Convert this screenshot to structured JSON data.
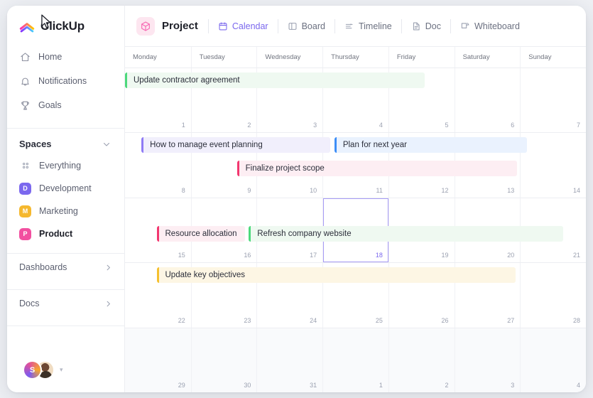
{
  "brand": {
    "name": "ClickUp",
    "logo_icon": "clickup-logo-icon"
  },
  "sidebar": {
    "nav": [
      {
        "label": "Home",
        "icon": "home-icon"
      },
      {
        "label": "Notifications",
        "icon": "bell-icon"
      },
      {
        "label": "Goals",
        "icon": "trophy-icon"
      }
    ],
    "spaces_section": {
      "title": "Spaces",
      "chevron": "chevron-down-icon"
    },
    "spaces": [
      {
        "label": "Everything",
        "badge": "",
        "color": "",
        "icon": "grid-dots-icon",
        "active": false
      },
      {
        "label": "Development",
        "badge": "D",
        "color": "#7b68ee",
        "active": false
      },
      {
        "label": "Marketing",
        "badge": "M",
        "color": "#f5b82e",
        "active": false
      },
      {
        "label": "Product",
        "badge": "P",
        "color": "#f24fa0",
        "active": true
      }
    ],
    "links": [
      {
        "label": "Dashboards",
        "chevron": "chevron-right-icon"
      },
      {
        "label": "Docs",
        "chevron": "chevron-right-icon"
      }
    ],
    "footer": {
      "avatar_initial": "S",
      "avatar_photo": "user-photo-avatar",
      "caret": "chevron-down-icon"
    }
  },
  "toolbar": {
    "project_name": "Project",
    "project_icon": "cube-icon",
    "tabs": [
      {
        "label": "Calendar",
        "icon": "calendar-icon",
        "active": true
      },
      {
        "label": "Board",
        "icon": "board-icon",
        "active": false
      },
      {
        "label": "Timeline",
        "icon": "timeline-icon",
        "active": false
      },
      {
        "label": "Doc",
        "icon": "doc-icon",
        "active": false
      },
      {
        "label": "Whiteboard",
        "icon": "whiteboard-icon",
        "active": false
      }
    ],
    "accent_color": "#7b68ee"
  },
  "calendar": {
    "day_names": [
      "Monday",
      "Tuesday",
      "Wednesday",
      "Thursday",
      "Friday",
      "Saturday",
      "Sunday"
    ],
    "today": 18,
    "weeks": [
      {
        "days": [
          1,
          2,
          3,
          4,
          5,
          6,
          7
        ],
        "out_of_month": false
      },
      {
        "days": [
          8,
          9,
          10,
          11,
          12,
          13,
          14
        ],
        "out_of_month": false
      },
      {
        "days": [
          15,
          16,
          17,
          18,
          19,
          20,
          21
        ],
        "out_of_month": false
      },
      {
        "days": [
          22,
          23,
          24,
          25,
          26,
          27,
          28
        ],
        "out_of_month": false
      },
      {
        "days": [
          29,
          30,
          31,
          1,
          2,
          3,
          4
        ],
        "out_of_month": true
      }
    ],
    "events": [
      {
        "title": "Update contractor agreement",
        "week": 0,
        "row": 0,
        "start_day": 0,
        "end_day": 4.55,
        "accent": "#4cd97b",
        "fill": "#eff9f1"
      },
      {
        "title": "How to manage event planning",
        "week": 1,
        "row": 0,
        "start_day": 0.25,
        "end_day": 3.12,
        "accent": "#8f7bf5",
        "fill": "#f1effc"
      },
      {
        "title": "Plan for next year",
        "week": 1,
        "row": 0,
        "start_day": 3.18,
        "end_day": 6.1,
        "accent": "#3d8ef7",
        "fill": "#eaf2fe"
      },
      {
        "title": "Finalize project scope",
        "week": 1,
        "row": 1,
        "start_day": 1.7,
        "end_day": 5.95,
        "accent": "#f2376f",
        "fill": "#fdeef3"
      },
      {
        "title": "Resource allocation",
        "week": 2,
        "row": 1,
        "start_day": 0.48,
        "end_day": 1.82,
        "accent": "#f2376f",
        "fill": "#fdeef3"
      },
      {
        "title": "Refresh company website",
        "week": 2,
        "row": 1,
        "start_day": 1.88,
        "end_day": 6.65,
        "accent": "#4cd97b",
        "fill": "#eff9f1"
      },
      {
        "title": "Update key objectives",
        "week": 3,
        "row": 0,
        "start_day": 0.48,
        "end_day": 5.93,
        "accent": "#f5c02e",
        "fill": "#fdf6e4"
      }
    ]
  },
  "cursor": {
    "icon": "mouse-pointer-icon"
  }
}
